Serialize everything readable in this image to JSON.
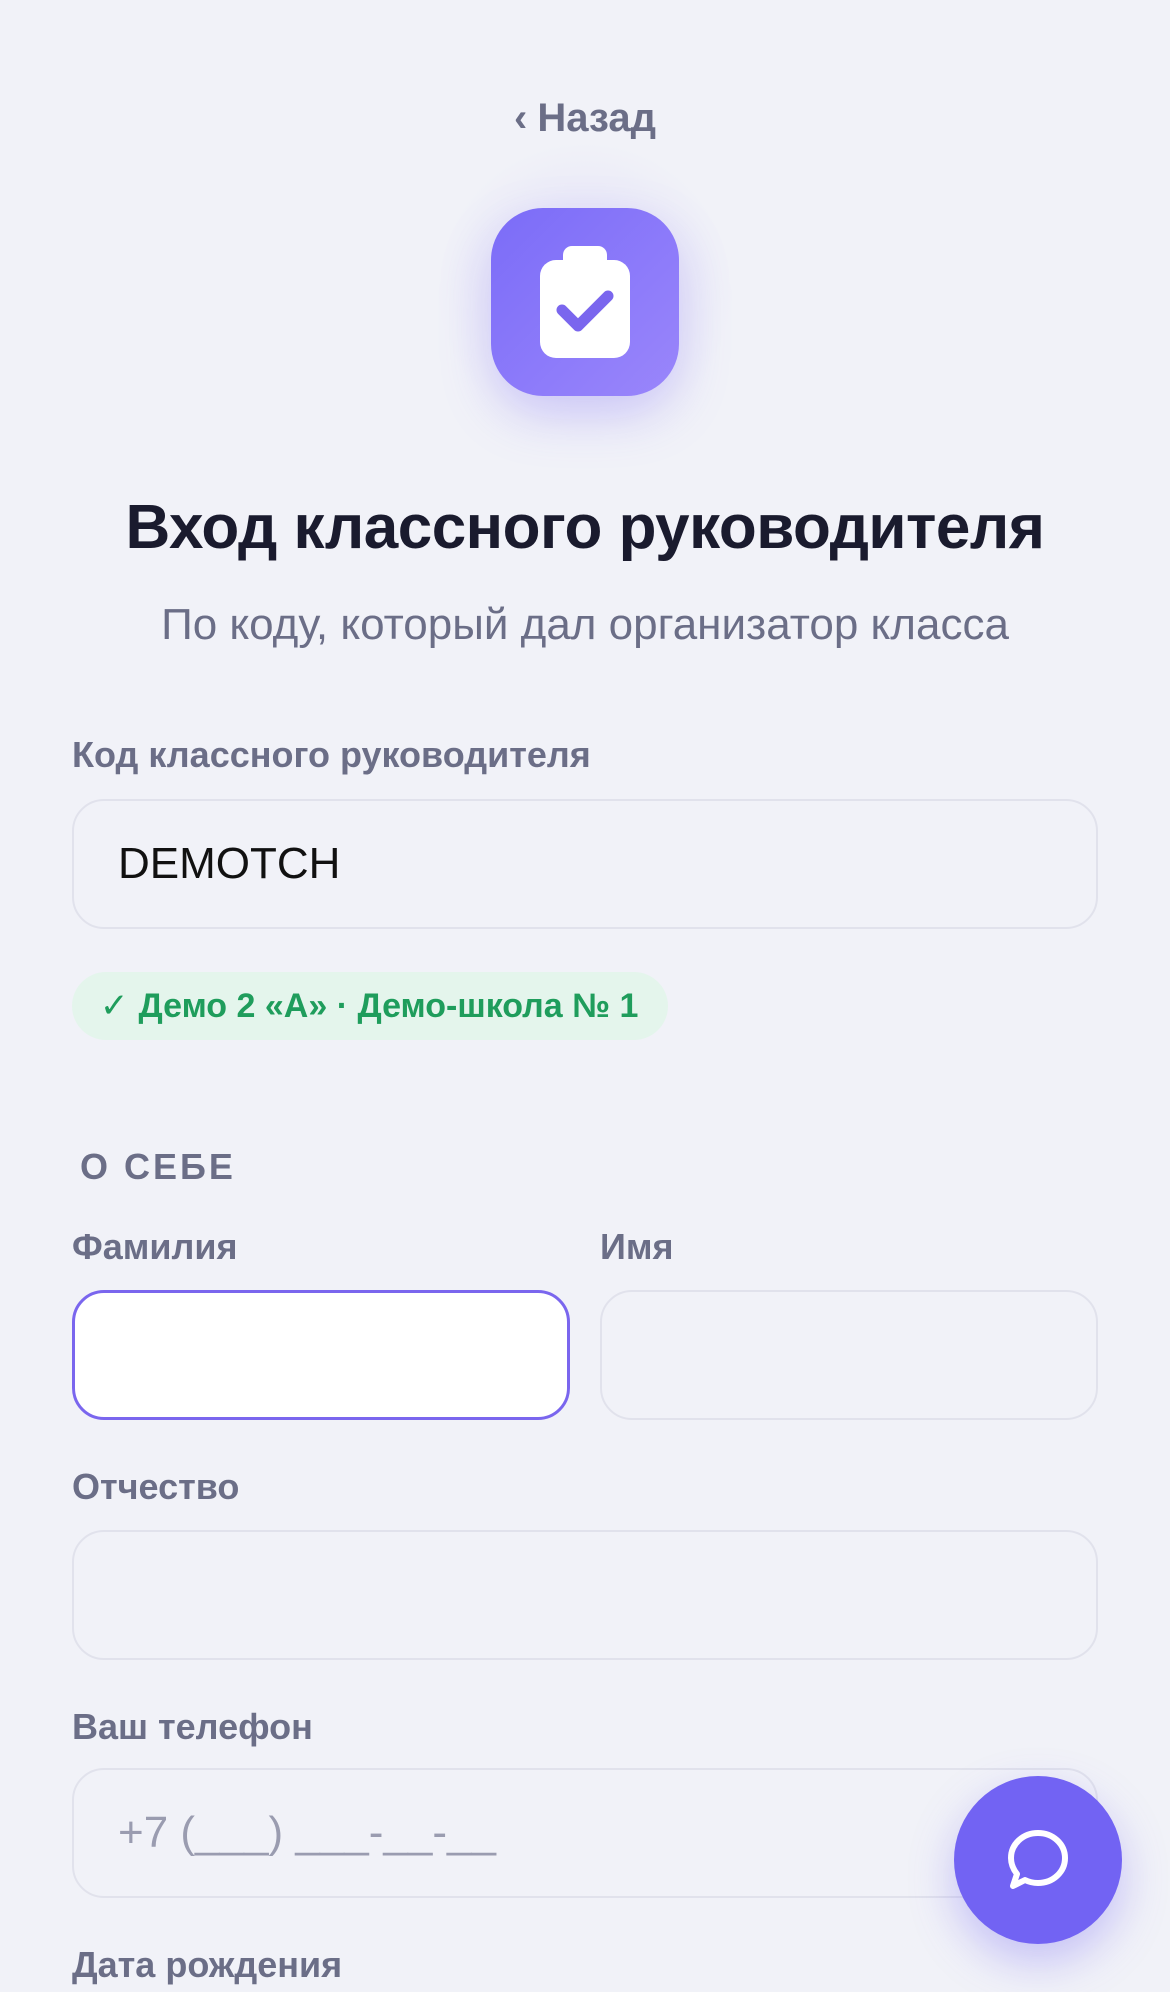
{
  "nav": {
    "back_chevron": "‹",
    "back_label": "Назад"
  },
  "header": {
    "icon": "clipboard-check-icon",
    "title": "Вход классного руководителя",
    "subtitle": "По коду, который дал организатор класса"
  },
  "code_field": {
    "label": "Код классного руководителя",
    "value": "DEMOTCH"
  },
  "code_status": {
    "check": "✓",
    "text": "Демо 2 «А» · Демо-школа № 1"
  },
  "about_section": {
    "heading": "О СЕБЕ",
    "last_name": {
      "label": "Фамилия",
      "value": ""
    },
    "first_name": {
      "label": "Имя",
      "value": ""
    },
    "middle_name": {
      "label": "Отчество",
      "value": ""
    },
    "phone": {
      "label": "Ваш телефон",
      "placeholder": "+7 (___) ___-__-__"
    },
    "birth_date": {
      "label": "Дата рождения"
    }
  },
  "chat_button": {
    "icon": "chat-bubble-icon"
  },
  "colors": {
    "background": "#f1f2f8",
    "accent": "#7263f3",
    "success_text": "#1f9d5c",
    "success_bg": "#e4f5ec",
    "muted_text": "#6b6e87"
  }
}
